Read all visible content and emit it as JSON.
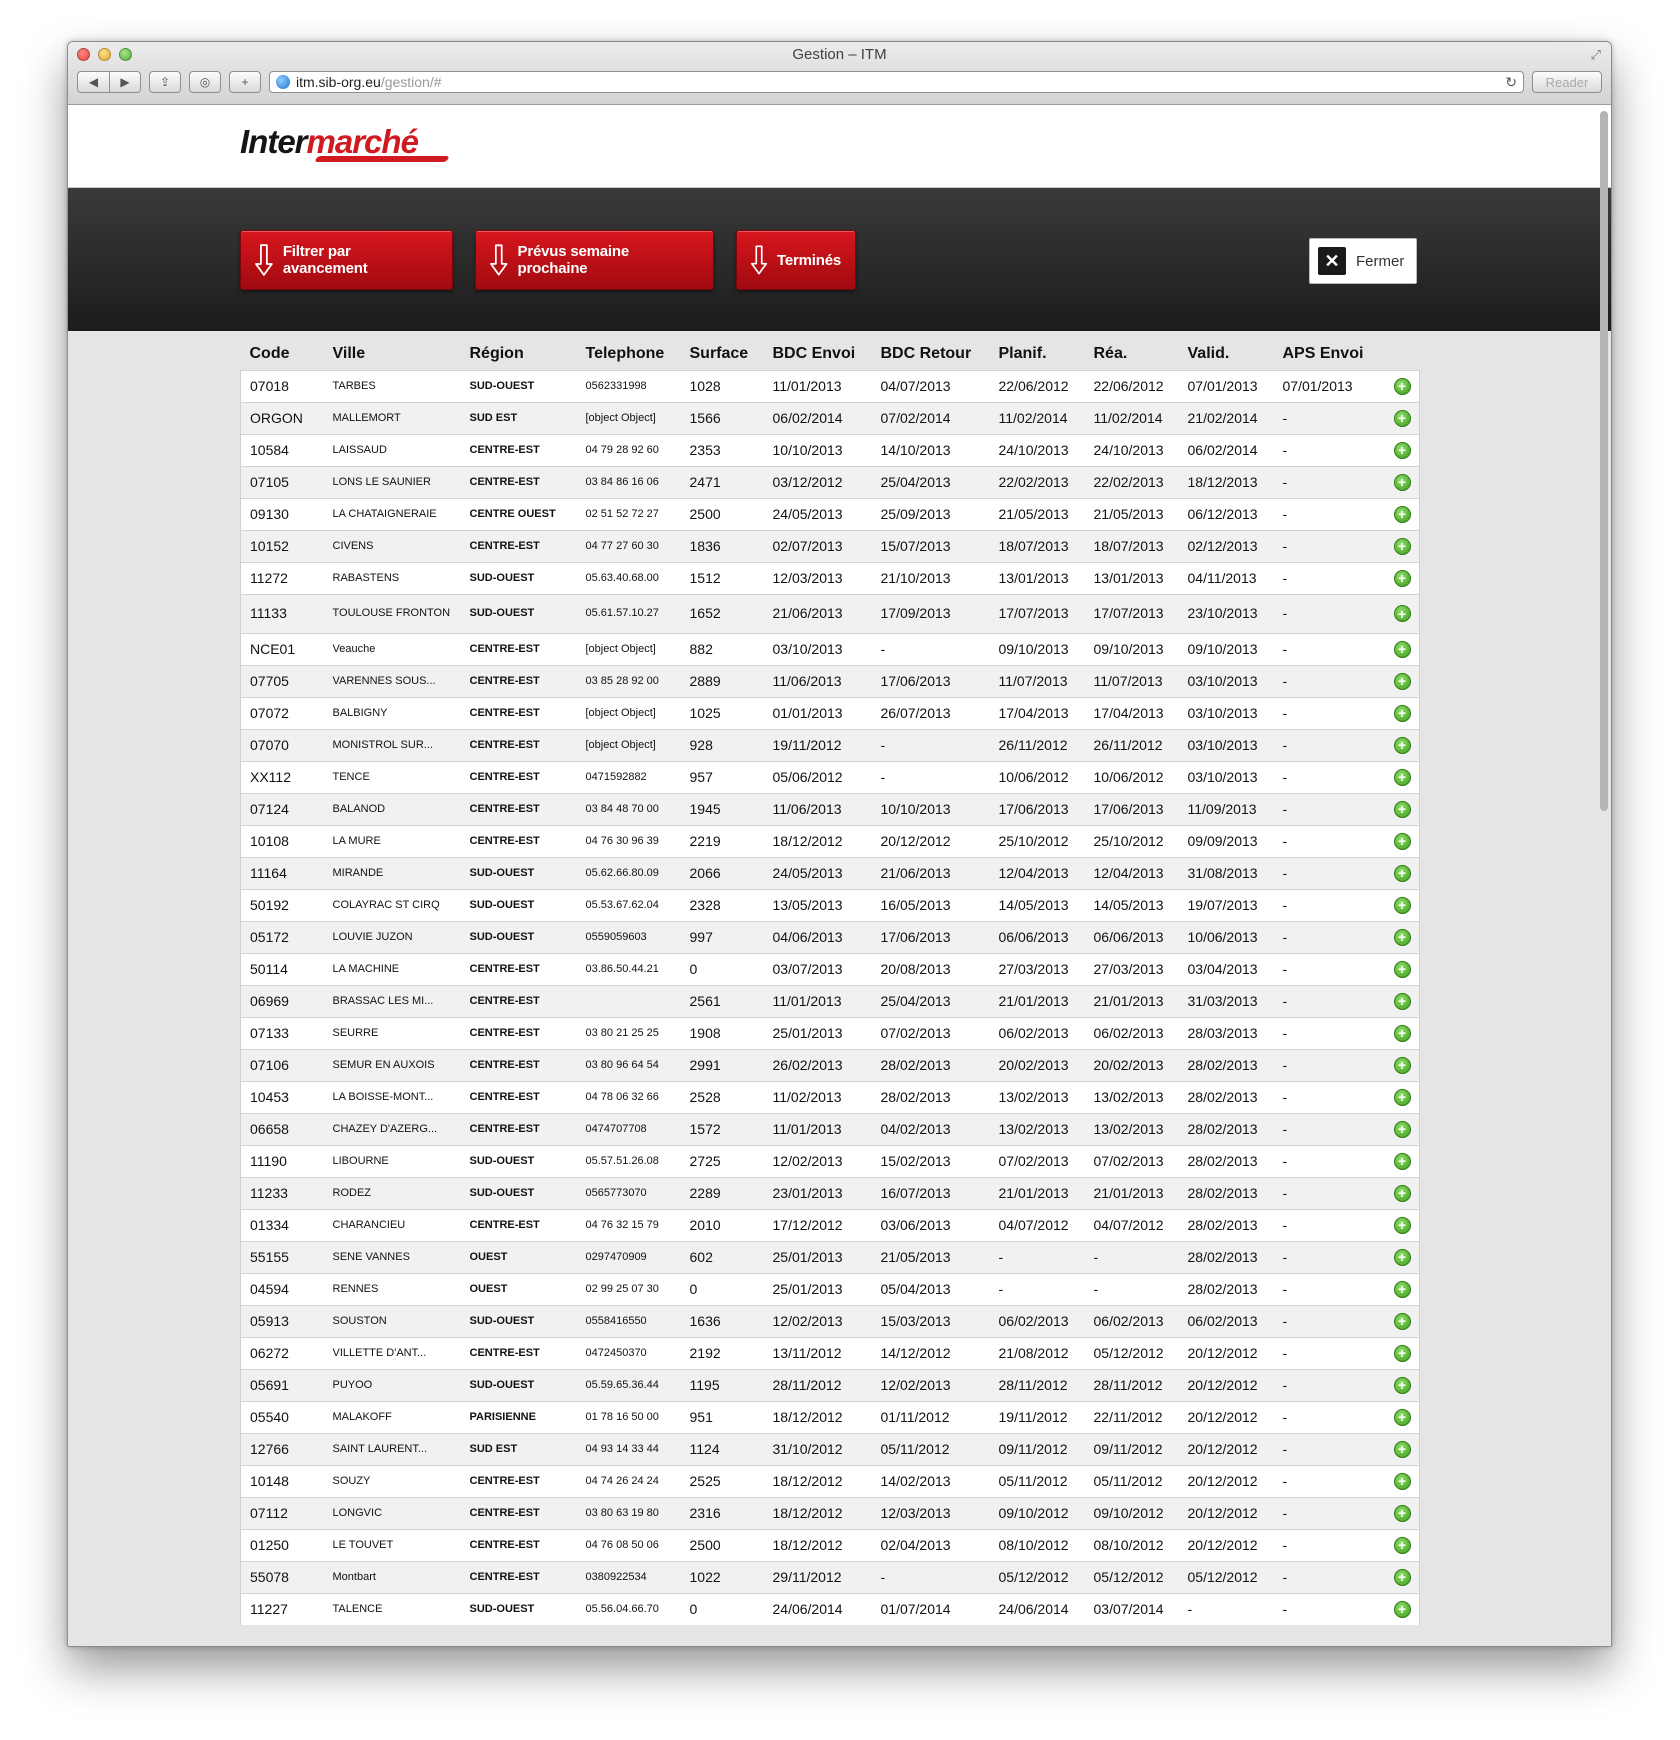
{
  "window": {
    "title": "Gestion – ITM",
    "url_host": "itm.sib-org.eu",
    "url_path": "/gestion/#",
    "reader_label": "Reader",
    "nav_back": "◀",
    "nav_forward": "▶",
    "share_icon": "⇪",
    "topsites_icon": "◎",
    "newtab_icon": "+",
    "reload_icon": "↻",
    "fullscreen_icon": "⤢"
  },
  "brand": {
    "logo_part1": "Inter",
    "logo_part2": "marché",
    "accent": "#d11a20"
  },
  "actions": {
    "filter_label": "Filtrer par avancement",
    "next_week_label": "Prévus semaine prochaine",
    "done_label": "Terminés",
    "close_label": "Fermer",
    "close_icon": "✕"
  },
  "table": {
    "headers": [
      "Code",
      "Ville",
      "Région",
      "Telephone",
      "Surface",
      "BDC Envoi",
      "BDC Retour",
      "Planif.",
      "Réa.",
      "Valid.",
      "APS Envoi",
      ""
    ],
    "rows": [
      [
        "07018",
        "TARBES",
        "SUD-OUEST",
        "0562331998",
        "1028",
        "11/01/2013",
        "04/07/2013",
        "22/06/2012",
        "22/06/2012",
        "07/01/2013",
        "07/01/2013"
      ],
      [
        "ORGON",
        "MALLEMORT",
        "SUD EST",
        "[object Object]",
        "1566",
        "06/02/2014",
        "07/02/2014",
        "11/02/2014",
        "11/02/2014",
        "21/02/2014",
        "-"
      ],
      [
        "10584",
        "LAISSAUD",
        "CENTRE-EST",
        "04 79 28 92 60",
        "2353",
        "10/10/2013",
        "14/10/2013",
        "24/10/2013",
        "24/10/2013",
        "06/02/2014",
        "-"
      ],
      [
        "07105",
        "LONS LE SAUNIER",
        "CENTRE-EST",
        "03 84 86 16 06",
        "2471",
        "03/12/2012",
        "25/04/2013",
        "22/02/2013",
        "22/02/2013",
        "18/12/2013",
        "-"
      ],
      [
        "09130",
        "LA CHATAIGNERAIE",
        "CENTRE OUEST",
        "02 51 52 72 27",
        "2500",
        "24/05/2013",
        "25/09/2013",
        "21/05/2013",
        "21/05/2013",
        "06/12/2013",
        "-"
      ],
      [
        "10152",
        "CIVENS",
        "CENTRE-EST",
        "04 77 27 60 30",
        "1836",
        "02/07/2013",
        "15/07/2013",
        "18/07/2013",
        "18/07/2013",
        "02/12/2013",
        "-"
      ],
      [
        "11272",
        "RABASTENS",
        "SUD-OUEST",
        "05.63.40.68.00",
        "1512",
        "12/03/2013",
        "21/10/2013",
        "13/01/2013",
        "13/01/2013",
        "04/11/2013",
        "-"
      ],
      [
        "11133",
        "TOULOUSE FRONTON",
        "SUD-OUEST",
        "05.61.57.10.27",
        "1652",
        "21/06/2013",
        "17/09/2013",
        "17/07/2013",
        "17/07/2013",
        "23/10/2013",
        "-"
      ],
      [
        "NCE01",
        "Veauche",
        "CENTRE-EST",
        "[object Object]",
        "882",
        "03/10/2013",
        "-",
        "09/10/2013",
        "09/10/2013",
        "09/10/2013",
        "-"
      ],
      [
        "07705",
        "VARENNES SOUS...",
        "CENTRE-EST",
        "03 85 28 92 00",
        "2889",
        "11/06/2013",
        "17/06/2013",
        "11/07/2013",
        "11/07/2013",
        "03/10/2013",
        "-"
      ],
      [
        "07072",
        "BALBIGNY",
        "CENTRE-EST",
        "[object Object]",
        "1025",
        "01/01/2013",
        "26/07/2013",
        "17/04/2013",
        "17/04/2013",
        "03/10/2013",
        "-"
      ],
      [
        "07070",
        "MONISTROL SUR...",
        "CENTRE-EST",
        "[object Object]",
        "928",
        "19/11/2012",
        "-",
        "26/11/2012",
        "26/11/2012",
        "03/10/2013",
        "-"
      ],
      [
        "XX112",
        "TENCE",
        "CENTRE-EST",
        "0471592882",
        "957",
        "05/06/2012",
        "-",
        "10/06/2012",
        "10/06/2012",
        "03/10/2013",
        "-"
      ],
      [
        "07124",
        "BALANOD",
        "CENTRE-EST",
        "03 84 48 70 00",
        "1945",
        "11/06/2013",
        "10/10/2013",
        "17/06/2013",
        "17/06/2013",
        "11/09/2013",
        "-"
      ],
      [
        "10108",
        "LA MURE",
        "CENTRE-EST",
        "04 76 30 96 39",
        "2219",
        "18/12/2012",
        "20/12/2012",
        "25/10/2012",
        "25/10/2012",
        "09/09/2013",
        "-"
      ],
      [
        "11164",
        "MIRANDE",
        "SUD-OUEST",
        "05.62.66.80.09",
        "2066",
        "24/05/2013",
        "21/06/2013",
        "12/04/2013",
        "12/04/2013",
        "31/08/2013",
        "-"
      ],
      [
        "50192",
        "COLAYRAC ST CIRQ",
        "SUD-OUEST",
        "05.53.67.62.04",
        "2328",
        "13/05/2013",
        "16/05/2013",
        "14/05/2013",
        "14/05/2013",
        "19/07/2013",
        "-"
      ],
      [
        "05172",
        "LOUVIE JUZON",
        "SUD-OUEST",
        "0559059603",
        "997",
        "04/06/2013",
        "17/06/2013",
        "06/06/2013",
        "06/06/2013",
        "10/06/2013",
        "-"
      ],
      [
        "50114",
        "LA MACHINE",
        "CENTRE-EST",
        "03.86.50.44.21",
        "0",
        "03/07/2013",
        "20/08/2013",
        "27/03/2013",
        "27/03/2013",
        "03/04/2013",
        "-"
      ],
      [
        "06969",
        "BRASSAC LES MI...",
        "CENTRE-EST",
        "",
        "2561",
        "11/01/2013",
        "25/04/2013",
        "21/01/2013",
        "21/01/2013",
        "31/03/2013",
        "-"
      ],
      [
        "07133",
        "SEURRE",
        "CENTRE-EST",
        "03 80 21 25 25",
        "1908",
        "25/01/2013",
        "07/02/2013",
        "06/02/2013",
        "06/02/2013",
        "28/03/2013",
        "-"
      ],
      [
        "07106",
        "SEMUR EN AUXOIS",
        "CENTRE-EST",
        "03 80 96 64 54",
        "2991",
        "26/02/2013",
        "28/02/2013",
        "20/02/2013",
        "20/02/2013",
        "28/02/2013",
        "-"
      ],
      [
        "10453",
        "LA BOISSE-MONT...",
        "CENTRE-EST",
        "04 78 06 32 66",
        "2528",
        "11/02/2013",
        "28/02/2013",
        "13/02/2013",
        "13/02/2013",
        "28/02/2013",
        "-"
      ],
      [
        "06658",
        "CHAZEY D'AZERG...",
        "CENTRE-EST",
        "0474707708",
        "1572",
        "11/01/2013",
        "04/02/2013",
        "13/02/2013",
        "13/02/2013",
        "28/02/2013",
        "-"
      ],
      [
        "11190",
        "LIBOURNE",
        "SUD-OUEST",
        "05.57.51.26.08",
        "2725",
        "12/02/2013",
        "15/02/2013",
        "07/02/2013",
        "07/02/2013",
        "28/02/2013",
        "-"
      ],
      [
        "11233",
        "RODEZ",
        "SUD-OUEST",
        "0565773070",
        "2289",
        "23/01/2013",
        "16/07/2013",
        "21/01/2013",
        "21/01/2013",
        "28/02/2013",
        "-"
      ],
      [
        "01334",
        "CHARANCIEU",
        "CENTRE-EST",
        "04 76 32 15 79",
        "2010",
        "17/12/2012",
        "03/06/2013",
        "04/07/2012",
        "04/07/2012",
        "28/02/2013",
        "-"
      ],
      [
        "55155",
        "SENE VANNES",
        "OUEST",
        "0297470909",
        "602",
        "25/01/2013",
        "21/05/2013",
        "-",
        "-",
        "28/02/2013",
        "-"
      ],
      [
        "04594",
        "RENNES",
        "OUEST",
        "02 99 25 07 30",
        "0",
        "25/01/2013",
        "05/04/2013",
        "-",
        "-",
        "28/02/2013",
        "-"
      ],
      [
        "05913",
        "SOUSTON",
        "SUD-OUEST",
        "0558416550",
        "1636",
        "12/02/2013",
        "15/03/2013",
        "06/02/2013",
        "06/02/2013",
        "06/02/2013",
        "-"
      ],
      [
        "06272",
        "VILLETTE D'ANT...",
        "CENTRE-EST",
        "0472450370",
        "2192",
        "13/11/2012",
        "14/12/2012",
        "21/08/2012",
        "05/12/2012",
        "20/12/2012",
        "-"
      ],
      [
        "05691",
        "PUYOO",
        "SUD-OUEST",
        "05.59.65.36.44",
        "1195",
        "28/11/2012",
        "12/02/2013",
        "28/11/2012",
        "28/11/2012",
        "20/12/2012",
        "-"
      ],
      [
        "05540",
        "MALAKOFF",
        "PARISIENNE",
        "01 78 16 50 00",
        "951",
        "18/12/2012",
        "01/11/2012",
        "19/11/2012",
        "22/11/2012",
        "20/12/2012",
        "-"
      ],
      [
        "12766",
        "SAINT LAURENT...",
        "SUD EST",
        "04 93 14 33 44",
        "1124",
        "31/10/2012",
        "05/11/2012",
        "09/11/2012",
        "09/11/2012",
        "20/12/2012",
        "-"
      ],
      [
        "10148",
        "SOUZY",
        "CENTRE-EST",
        "04 74 26 24 24",
        "2525",
        "18/12/2012",
        "14/02/2013",
        "05/11/2012",
        "05/11/2012",
        "20/12/2012",
        "-"
      ],
      [
        "07112",
        "LONGVIC",
        "CENTRE-EST",
        "03 80 63 19 80",
        "2316",
        "18/12/2012",
        "12/03/2013",
        "09/10/2012",
        "09/10/2012",
        "20/12/2012",
        "-"
      ],
      [
        "01250",
        "LE TOUVET",
        "CENTRE-EST",
        "04 76 08 50 06",
        "2500",
        "18/12/2012",
        "02/04/2013",
        "08/10/2012",
        "08/10/2012",
        "20/12/2012",
        "-"
      ],
      [
        "55078",
        "Montbart",
        "CENTRE-EST",
        "0380922534",
        "1022",
        "29/11/2012",
        "-",
        "05/12/2012",
        "05/12/2012",
        "05/12/2012",
        "-"
      ],
      [
        "11227",
        "TALENCE",
        "SUD-OUEST",
        "05.56.04.66.70",
        "0",
        "24/06/2014",
        "01/07/2014",
        "24/06/2014",
        "03/07/2014",
        "-",
        "-"
      ]
    ]
  }
}
